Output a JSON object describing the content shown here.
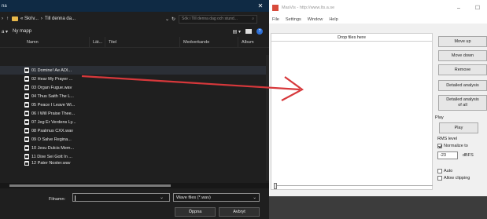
{
  "dialog": {
    "title": "na",
    "close_glyph": "✕",
    "breadcrumb": [
      "« Skriv...",
      "Till denna da..."
    ],
    "search_placeholder": "Sök i Till denna dag och stund...",
    "new_folder": "Ny mapp",
    "columns": [
      "Namn",
      "Lät...",
      "Titel",
      "Medverkande",
      "Album"
    ],
    "files": [
      "01 Domine! Ae ADI...",
      "02 Hear My Prayer ...",
      "03 Organ Fugue.wav",
      "04 Thus Saith The L...",
      "05 Peace I Leave Wi...",
      "06 I Will Praise Thee...",
      "07 Jeg Er Verdens Ly...",
      "08 Psalmus CXX.wav",
      "09 O Salve Regina...",
      "10 Jesu Dulcis Mem...",
      "11 Dixe Sei Gott In ...",
      "12 Pater Noster.wav"
    ],
    "filename_label": "Filnamn:",
    "filename_value": "",
    "filetype": "Wave files (*.wav)",
    "open_label": "Öppna",
    "cancel_label": "Avbryt"
  },
  "masvis": {
    "title": "MasVis - http://www.lts.a.se",
    "menu": [
      "File",
      "Settings",
      "Window",
      "Help"
    ],
    "drop_label": "Drop files here",
    "buttons": {
      "move_up": "Move up",
      "move_down": "Move down",
      "remove": "Remove",
      "detailed": "Detailed analysis",
      "detailed_all_1": "Detailed analysis",
      "detailed_all_2": "of all",
      "play": "Play"
    },
    "play_group": "Play",
    "rms_group": "RMS level",
    "normalize_label": "Normalize to",
    "normalize_checked": true,
    "level_value": "-23",
    "level_unit": "dBFS",
    "auto_label": "Auto",
    "auto_checked": false,
    "clipping_label": "Allow clipping",
    "clipping_checked": false
  },
  "colors": {
    "arrow": "#d7383b",
    "dialog_bg": "#1f1f1f",
    "accent": "#2d6fd6"
  }
}
